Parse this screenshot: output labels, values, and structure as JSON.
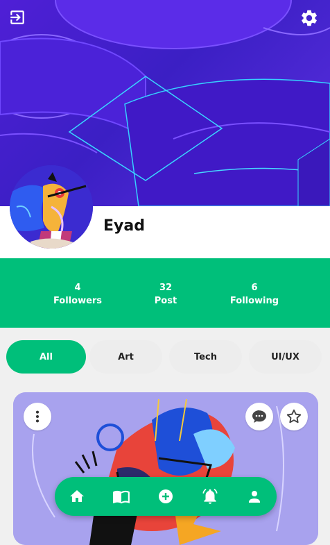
{
  "profile": {
    "username": "Eyad"
  },
  "stats": [
    {
      "value": "4",
      "label": "Followers"
    },
    {
      "value": "32",
      "label": "Post"
    },
    {
      "value": "6",
      "label": "Following"
    }
  ],
  "tabs": [
    {
      "label": "All",
      "active": true
    },
    {
      "label": "Art",
      "active": false
    },
    {
      "label": "Tech",
      "active": false
    },
    {
      "label": "UI/UX",
      "active": false
    }
  ],
  "icons": {
    "logout": "logout-icon",
    "settings": "gear-icon",
    "more": "more-vert-icon",
    "comment": "comment-icon",
    "favorite": "star-outline-icon",
    "nav": [
      "home-icon",
      "book-icon",
      "add-circle-icon",
      "bell-icon",
      "person-icon"
    ]
  },
  "colors": {
    "accent": "#00bf7a",
    "cover": "#4f1fd6",
    "card_background": "#a8a2ee",
    "page_background": "#f0f0f0"
  }
}
